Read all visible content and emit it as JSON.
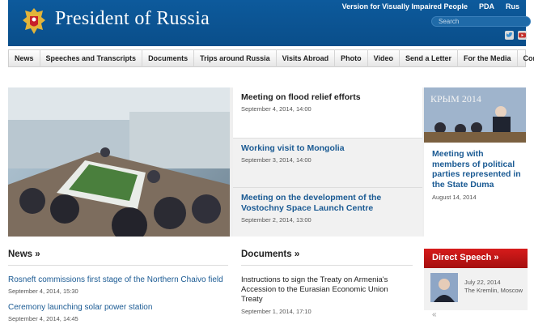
{
  "header": {
    "title": "President of Russia",
    "links": [
      "Version for Visually Impaired People",
      "PDA",
      "Rus"
    ],
    "search_placeholder": "Search",
    "social": [
      "twitter-icon",
      "youtube-icon"
    ]
  },
  "nav": {
    "items": [
      "News",
      "Speeches and Transcripts",
      "Documents",
      "Trips around Russia",
      "Visits Abroad",
      "Photo",
      "Video",
      "Send a Letter",
      "For the Media",
      "Contacts"
    ]
  },
  "feature": {
    "headlines": [
      {
        "title": "Meeting on flood relief efforts",
        "date": "September 4, 2014, 14:00"
      },
      {
        "title": "Working visit to Mongolia",
        "date": "September 3, 2014, 14:00"
      },
      {
        "title": "Meeting on the development of the Vostochny Space Launch Centre",
        "date": "September 2, 2014, 13:00"
      }
    ],
    "side": {
      "photo_caption": "КРЫМ 2014",
      "title": "Meeting with members of political parties represented in the State Duma",
      "date": "August 14, 2014"
    }
  },
  "news": {
    "heading": "News »",
    "items": [
      {
        "title": "Rosneft commissions first stage of the Northern Chaivo field",
        "date": "September 4, 2014, 15:30"
      },
      {
        "title": "Ceremony launching solar power station",
        "date": "September 4, 2014, 14:45"
      }
    ]
  },
  "documents": {
    "heading": "Documents »",
    "items": [
      {
        "title": "Instructions to sign the Treaty on Armenia's Accession to the Eurasian Economic Union Treaty",
        "date": "September 1, 2014, 17:10"
      }
    ]
  },
  "direct_speech": {
    "heading": "Direct Speech »",
    "date": "July 22, 2014",
    "place": "The Kremlin, Moscow"
  },
  "colors": {
    "header_blue": "#0a4e8a",
    "link_blue": "#1a5a93",
    "direct_speech_red": "#c41414"
  }
}
